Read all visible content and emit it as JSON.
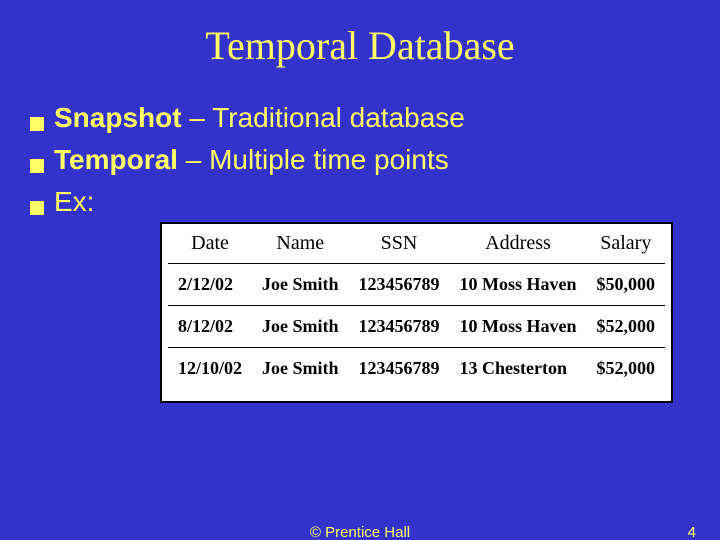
{
  "title": "Temporal Database",
  "bullets": [
    {
      "strong": "Snapshot",
      "rest": " – Traditional database"
    },
    {
      "strong": "Temporal",
      "rest": " – Multiple time points"
    },
    {
      "strong": "",
      "rest": "Ex:"
    }
  ],
  "table": {
    "headers": [
      "Date",
      "Name",
      "SSN",
      "Address",
      "Salary"
    ],
    "rows": [
      [
        "2/12/02",
        "Joe Smith",
        "123456789",
        "10 Moss Haven",
        "$50,000"
      ],
      [
        "8/12/02",
        "Joe Smith",
        "123456789",
        "10 Moss Haven",
        "$52,000"
      ],
      [
        "12/10/02",
        "Joe Smith",
        "123456789",
        "13 Chesterton",
        "$52,000"
      ]
    ]
  },
  "footer": {
    "copyright": "© Prentice Hall",
    "page": "4"
  },
  "chart_data": {
    "type": "table",
    "title": "Temporal Database",
    "columns": [
      "Date",
      "Name",
      "SSN",
      "Address",
      "Salary"
    ],
    "rows": [
      {
        "Date": "2/12/02",
        "Name": "Joe Smith",
        "SSN": "123456789",
        "Address": "10 Moss Haven",
        "Salary": "$50,000"
      },
      {
        "Date": "8/12/02",
        "Name": "Joe Smith",
        "SSN": "123456789",
        "Address": "10 Moss Haven",
        "Salary": "$52,000"
      },
      {
        "Date": "12/10/02",
        "Name": "Joe Smith",
        "SSN": "123456789",
        "Address": "13 Chesterton",
        "Salary": "$52,000"
      }
    ]
  }
}
